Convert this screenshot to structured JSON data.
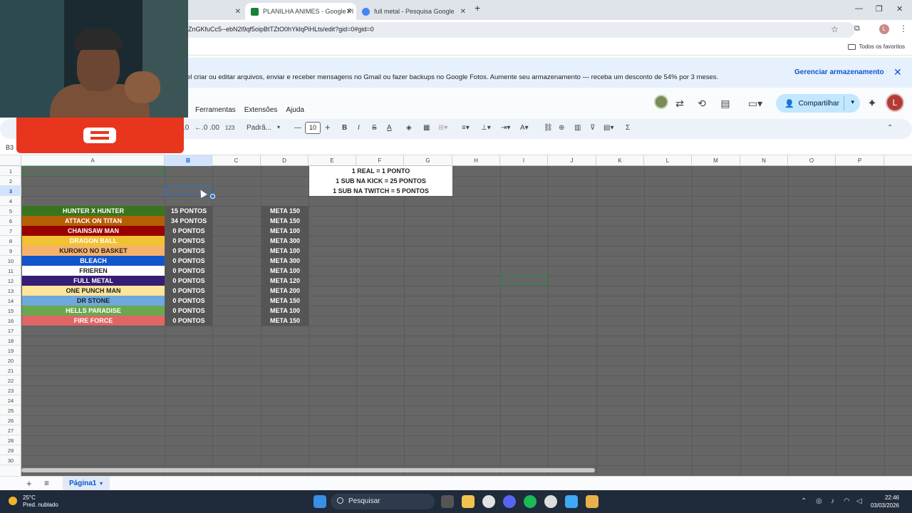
{
  "browser": {
    "tabs": [
      {
        "label": "",
        "active": false
      },
      {
        "label": "PLANILHA ANIMES - Google Pl",
        "active": true
      },
      {
        "label": "full metal - Pesquisa Google",
        "active": false
      }
    ],
    "url": "ZnGKfuCc5--ebN2l9qf5oipBtTZtO0hYklqPiHLts/edit?gid=0#gid=0",
    "bookmarks_label": "Todos os favoritos",
    "profile_letter": "L"
  },
  "banner": {
    "message": "el criar ou editar arquivos, enviar e receber mensagens no Gmail ou fazer backups no Google Fotos. Aumente seu armazenamento — receba um desconto de 54% por 3 meses.",
    "manage_label": "Gerenciar armazenamento"
  },
  "menu": [
    "Ferramentas",
    "Extensões",
    "Ajuda"
  ],
  "share_label": "Compartilhar",
  "avatar_letter": "L",
  "toolbar": {
    "zoom_percent": ".0",
    "decimal": ".00",
    "number_format": "123",
    "font": "Padrã...",
    "font_size": "10"
  },
  "cell_ref": "B3",
  "columns": [
    "A",
    "B",
    "C",
    "D",
    "E",
    "F",
    "G",
    "H",
    "I",
    "J",
    "K",
    "L",
    "M",
    "N",
    "O",
    "P"
  ],
  "selected_column": "B",
  "selected_row": 3,
  "rows": [
    "1",
    "2",
    "3",
    "4",
    "5",
    "6",
    "7",
    "8",
    "9",
    "10",
    "11",
    "12",
    "13",
    "14",
    "15",
    "16",
    "17",
    "18",
    "19",
    "20",
    "21",
    "22",
    "23",
    "24",
    "25",
    "26",
    "27",
    "28",
    "29",
    "30"
  ],
  "legend": [
    "1 REAL = 1 PONTO",
    "1 SUB NA KICK = 25 PONTOS",
    "1 SUB NA TWITCH = 5 PONTOS"
  ],
  "animes": [
    {
      "name": "HUNTER X HUNTER",
      "points": "15 PONTOS",
      "goal": "META 150",
      "bg": "#38761d",
      "fg": "#ffffff"
    },
    {
      "name": "ATTACK ON TITAN",
      "points": "34 PONTOS",
      "goal": "META 150",
      "bg": "#b45f06",
      "fg": "#ffffff"
    },
    {
      "name": "CHAINSAW MAN",
      "points": "0 PONTOS",
      "goal": "META 100",
      "bg": "#990000",
      "fg": "#ffffff"
    },
    {
      "name": "DRAGON BALL",
      "points": "0 PONTOS",
      "goal": "META 300",
      "bg": "#f1c232",
      "fg": "#ffffff"
    },
    {
      "name": "KUROKO NO BASKET",
      "points": "0 PONTOS",
      "goal": "META 100",
      "bg": "#f6b26b",
      "fg": "#1f1f1f"
    },
    {
      "name": "BLEACH",
      "points": "0 PONTOS",
      "goal": "META 300",
      "bg": "#1155cc",
      "fg": "#ffffff"
    },
    {
      "name": "FRIEREN",
      "points": "0 PONTOS",
      "goal": "META 100",
      "bg": "#ffffff",
      "fg": "#1f1f1f"
    },
    {
      "name": "FULL METAL",
      "points": "0 PONTOS",
      "goal": "META 120",
      "bg": "#351c75",
      "fg": "#ffffff"
    },
    {
      "name": "ONE PUNCH MAN",
      "points": "0 PONTOS",
      "goal": "META 200",
      "bg": "#ffe599",
      "fg": "#1f1f1f"
    },
    {
      "name": "DR STONE",
      "points": "0 PONTOS",
      "goal": "META 150",
      "bg": "#6fa8dc",
      "fg": "#1f1f1f"
    },
    {
      "name": "HELLS PARADISE",
      "points": "0 PONTOS",
      "goal": "META 100",
      "bg": "#6aa84f",
      "fg": "#ffffff"
    },
    {
      "name": "FIRE FORCE",
      "points": "0 PONTOS",
      "goal": "META 150",
      "bg": "#e06666",
      "fg": "#ffffff"
    }
  ],
  "sheet_tab": "Página1",
  "taskbar": {
    "temperature": "25°C",
    "weather": "Pred. nublado",
    "search_placeholder": "Pesquisar",
    "time": "22:46",
    "date": "03/03/2026"
  }
}
